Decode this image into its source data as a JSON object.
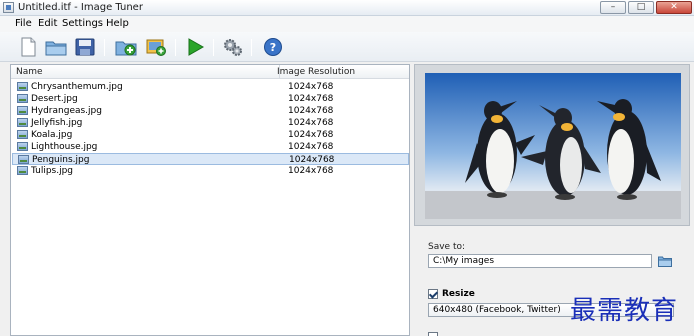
{
  "window": {
    "title": "Untitled.itf - Image Tuner"
  },
  "menu": [
    "File",
    "Edit",
    "Settings",
    "Help"
  ],
  "toolbar": {
    "buttons": [
      "new-file-icon",
      "open-folder-icon",
      "save-icon",
      "add-folder-icon",
      "add-images-icon",
      "start-icon",
      "settings-icon",
      "help-icon"
    ]
  },
  "file_list": {
    "columns": {
      "name": "Name",
      "resolution": "Image Resolution"
    },
    "rows": [
      {
        "name": "Chrysanthemum.jpg",
        "resolution": "1024x768"
      },
      {
        "name": "Desert.jpg",
        "resolution": "1024x768"
      },
      {
        "name": "Hydrangeas.jpg",
        "resolution": "1024x768"
      },
      {
        "name": "Jellyfish.jpg",
        "resolution": "1024x768"
      },
      {
        "name": "Koala.jpg",
        "resolution": "1024x768"
      },
      {
        "name": "Lighthouse.jpg",
        "resolution": "1024x768"
      },
      {
        "name": "Penguins.jpg",
        "resolution": "1024x768"
      },
      {
        "name": "Tulips.jpg",
        "resolution": "1024x768"
      }
    ],
    "selected": "Penguins.jpg"
  },
  "output": {
    "save_to_label": "Save to:",
    "save_to_value": "C:\\My images",
    "resize_label": "Resize",
    "resize_checked": true,
    "resize_preset": "640x480 (Facebook, Twitter)"
  },
  "watermark": "最需教育",
  "colors": {
    "selection": "#dbe8f7",
    "start_green": "#2aa52a",
    "help_blue": "#3a74c8",
    "watermark": "#1a2fb8"
  }
}
